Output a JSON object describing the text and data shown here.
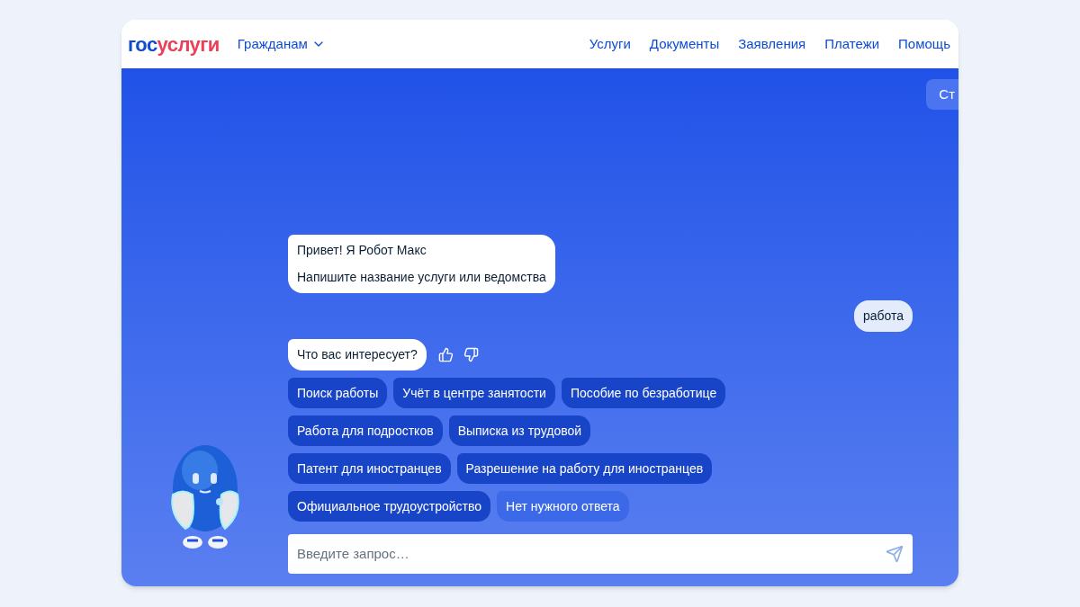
{
  "header": {
    "logo": {
      "prefix": "гос",
      "suffix": "услуги"
    },
    "audience_menu": "Гражданам",
    "nav": [
      "Услуги",
      "Документы",
      "Заявления",
      "Платежи",
      "Помощь"
    ]
  },
  "side_button": "Ст",
  "messages": [
    {
      "kind": "bot",
      "lines": [
        "Привет! Я Робот Макс",
        "Напишите название услуги или ведомства"
      ],
      "feedback": false
    },
    {
      "kind": "user",
      "lines": [
        "работа"
      ],
      "feedback": false
    },
    {
      "kind": "bot",
      "lines": [
        "Что вас интересует?"
      ],
      "feedback": true
    }
  ],
  "chips": [
    {
      "label": "Поиск работы",
      "kind": "option"
    },
    {
      "label": "Учёт в центре занятости",
      "kind": "option"
    },
    {
      "label": "Пособие по безработице",
      "kind": "option"
    },
    {
      "label": "Работа для подростков",
      "kind": "option"
    },
    {
      "label": "Выписка из трудовой",
      "kind": "option"
    },
    {
      "label": "Патент для иностранцев",
      "kind": "option"
    },
    {
      "label": "Разрешение на работу для иностранцев",
      "kind": "option"
    },
    {
      "label": "Официальное трудоустройство",
      "kind": "option"
    },
    {
      "label": "Нет нужного ответа",
      "kind": "fallback"
    }
  ],
  "input": {
    "placeholder": "Введите запрос…"
  }
}
